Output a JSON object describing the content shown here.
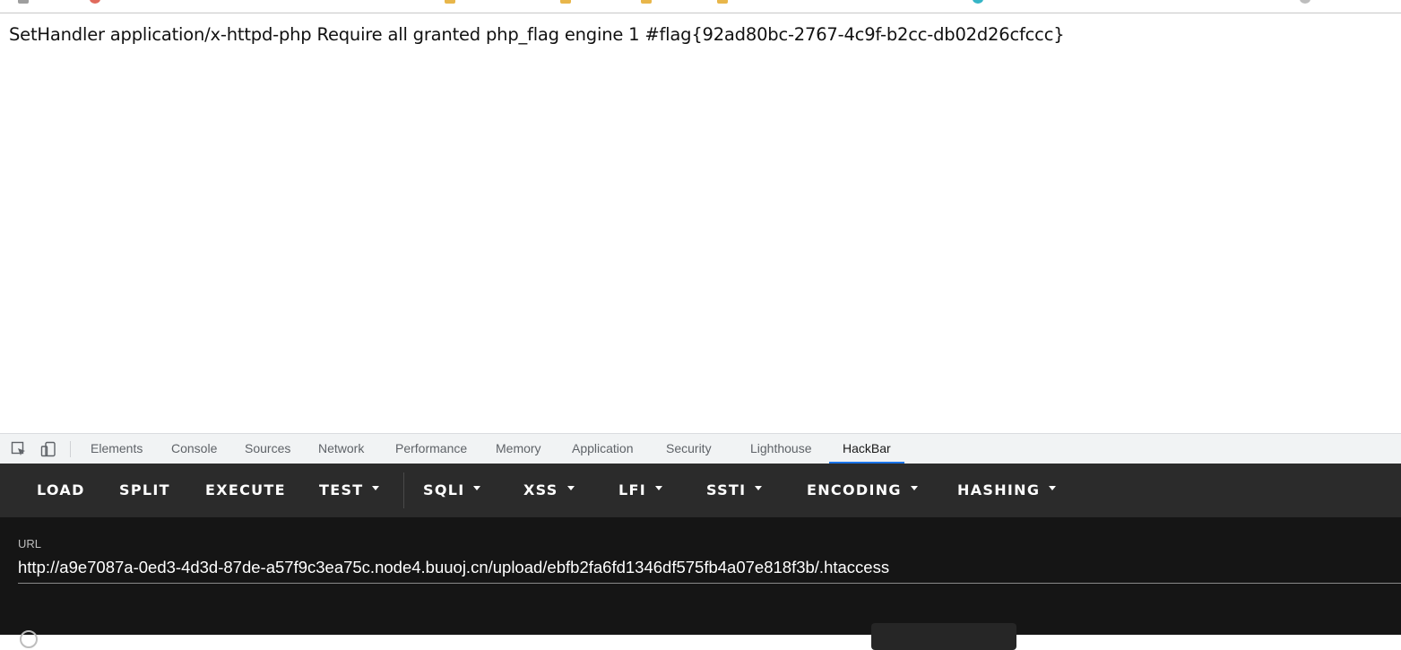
{
  "page": {
    "body_text": "SetHandler application/x-httpd-php Require all granted php_flag engine 1 #flag{92ad80bc-2767-4c9f-b2cc-db02d26cfccc}"
  },
  "devtools": {
    "tabs": [
      {
        "label": "Elements"
      },
      {
        "label": "Console"
      },
      {
        "label": "Sources"
      },
      {
        "label": "Network"
      },
      {
        "label": "Performance"
      },
      {
        "label": "Memory"
      },
      {
        "label": "Application"
      },
      {
        "label": "Security"
      },
      {
        "label": "Lighthouse"
      },
      {
        "label": "HackBar"
      }
    ],
    "active_tab": "HackBar",
    "accent_color": "#1a73e8"
  },
  "hackbar": {
    "buttons": [
      {
        "label": "LOAD",
        "dropdown": false
      },
      {
        "label": "SPLIT",
        "dropdown": false
      },
      {
        "label": "EXECUTE",
        "dropdown": false
      },
      {
        "label": "TEST",
        "dropdown": true
      },
      {
        "label": "SQLI",
        "dropdown": true
      },
      {
        "label": "XSS",
        "dropdown": true
      },
      {
        "label": "LFI",
        "dropdown": true
      },
      {
        "label": "SSTI",
        "dropdown": true
      },
      {
        "label": "ENCODING",
        "dropdown": true
      },
      {
        "label": "HASHING",
        "dropdown": true
      }
    ],
    "url_label": "URL",
    "url_value": "http://a9e7087a-0ed3-4d3d-87de-a57f9c3ea75c.node4.buuoj.cn/upload/ebfb2fa6fd1346df575fb4a07e818f3b/.htaccess",
    "menu_bg": "#2b2b2b",
    "body_bg": "#151515"
  },
  "icons": {
    "inspect": "inspect-element-icon",
    "device": "device-toolbar-icon"
  }
}
